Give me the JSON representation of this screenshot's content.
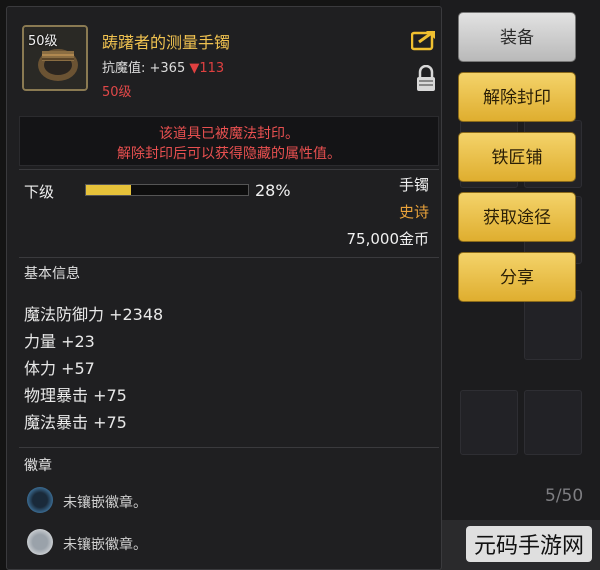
{
  "item": {
    "level_badge": "50级",
    "name": "踌躇者的测量手镯",
    "stat_label": "抗魔值: +365",
    "stat_down": "▼113",
    "level_req": "50级",
    "seal_line1": "该道具已被魔法封印。",
    "seal_line2": "解除封印后可以获得隐藏的属性值。",
    "grade": "下级",
    "grade_percent": "28%",
    "grade_fraction": 0.28,
    "type": "手镯",
    "rarity": "史诗",
    "price": "75,000金币"
  },
  "basic_info": {
    "title": "基本信息",
    "attrs": [
      "魔法防御力 +2348",
      "力量 +23",
      "体力 +57",
      "物理暴击 +75",
      "魔法暴击 +75"
    ]
  },
  "emblem": {
    "title": "徽章",
    "slots": [
      "未镶嵌徽章。",
      "未镶嵌徽章。"
    ]
  },
  "buttons": {
    "equip": "装备",
    "unseal": "解除封印",
    "blacksmith": "铁匠铺",
    "obtain": "获取途径",
    "share": "分享"
  },
  "background": {
    "inventory_count": "5/50"
  },
  "watermark": "元码手游网",
  "colors": {
    "gold": "#f0c250",
    "red": "#e04848",
    "button_gold": "#e8c04a"
  }
}
